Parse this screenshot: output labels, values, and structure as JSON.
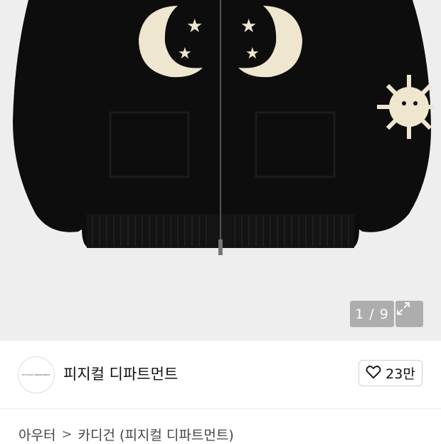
{
  "gallery": {
    "counter": "1 / 9",
    "expand_icon": "expand-arrows-icon",
    "image_alt": "black knit zip cardigan with moon and star pattern"
  },
  "store": {
    "avatar_text": "PHYSICAL DEPARTMENT",
    "name": "피지컬 디파트먼트",
    "like_icon": "heart-outline-icon",
    "likes": "23만"
  },
  "breadcrumb": {
    "items": [
      "아우터",
      "카디건 (피지컬 디파트먼트)"
    ],
    "separator": ">"
  },
  "colors": {
    "background": "#eeeeee",
    "garment": "#0d0d0d",
    "motif": "#efe6cf"
  }
}
